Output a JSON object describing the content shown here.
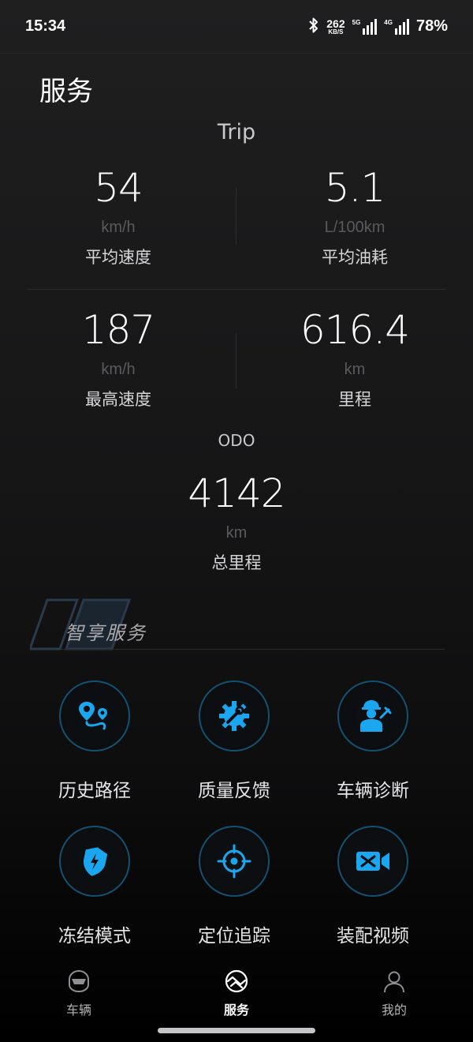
{
  "status_bar": {
    "time": "15:34",
    "net_speed_value": "262",
    "net_speed_unit": "KB/S",
    "sim1_label": "5G",
    "sim2_label": "4G",
    "battery": "78%",
    "icons": [
      "bluetooth-icon",
      "signal-5g-icon",
      "signal-4g-icon"
    ]
  },
  "page": {
    "title": "服务"
  },
  "trip": {
    "label": "Trip",
    "stats": [
      {
        "value": "54",
        "unit": "km/h",
        "name": "平均速度"
      },
      {
        "value": "5.1",
        "unit": "L/100km",
        "name": "平均油耗"
      },
      {
        "value": "187",
        "unit": "km/h",
        "name": "最高速度"
      },
      {
        "value": "616.4",
        "unit": "km",
        "name": "里程"
      }
    ]
  },
  "odo": {
    "label": "ODO",
    "value": "4142",
    "unit": "km",
    "name": "总里程"
  },
  "smart_services": {
    "title": "智享服务",
    "items": [
      {
        "label": "历史路径",
        "icon": "route-pin-icon"
      },
      {
        "label": "质量反馈",
        "icon": "gear-wrench-icon"
      },
      {
        "label": "车辆诊断",
        "icon": "mechanic-icon"
      },
      {
        "label": "冻结模式",
        "icon": "shield-bolt-icon"
      },
      {
        "label": "定位追踪",
        "icon": "locate-target-icon"
      },
      {
        "label": "装配视频",
        "icon": "video-camera-icon"
      }
    ]
  },
  "bottom_nav": {
    "items": [
      {
        "label": "车辆",
        "icon": "helmet-icon"
      },
      {
        "label": "服务",
        "icon": "service-wave-icon",
        "active": true
      },
      {
        "label": "我的",
        "icon": "person-icon"
      }
    ]
  },
  "colors": {
    "accent": "#1aa7f0",
    "ring": "#14506f",
    "background": "#161617"
  }
}
